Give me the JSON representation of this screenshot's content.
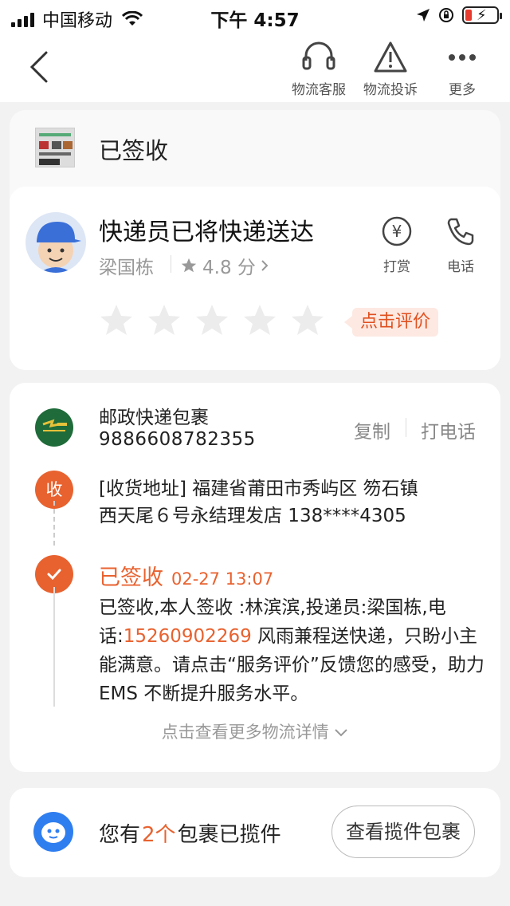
{
  "status_bar": {
    "carrier": "中国移动",
    "time": "下午 4:57"
  },
  "nav": {
    "actions": [
      {
        "label": "物流客服",
        "icon": "headset-icon"
      },
      {
        "label": "物流投诉",
        "icon": "warning-icon"
      },
      {
        "label": "更多",
        "icon": "more-icon"
      }
    ]
  },
  "status": {
    "title": "已签收"
  },
  "courier": {
    "headline": "快递员已将快递送达",
    "name": "梁国栋",
    "rating": "4.8 分",
    "rating_value": 4.8,
    "tip_label": "打赏",
    "call_label": "电话",
    "star_count": 5,
    "rate_button": "点击评价"
  },
  "tracking": {
    "carrier_name": "邮政快递包裹",
    "number": "9886608782355",
    "copy_label": "复制",
    "call_label": "打电话",
    "recv_badge": "收",
    "address_line1": "[收货地址] 福建省莆田市秀屿区  笏石镇",
    "address_line2": "西天尾６号永结理发店 138****4305",
    "event_title": "已签收",
    "event_time": "02-27 13:07",
    "event_desc_before": "已签收,本人签收 :林滨滨,投递员:梁国栋,电话:",
    "event_phone": "15260902269",
    "event_desc_after": " 风雨兼程送快递，只盼小主能满意。请点击“服务评价”反馈您的感受，助力 EMS 不断提升服务水平。",
    "more_link": "点击查看更多物流详情"
  },
  "packages": {
    "prefix": "您有",
    "count": "2个",
    "suffix": "包裹已揽件",
    "button": "查看揽件包裹"
  },
  "colors": {
    "accent": "#e8622f",
    "brand_blue": "#2f7ef0",
    "ems_green": "#1f6b3a"
  }
}
